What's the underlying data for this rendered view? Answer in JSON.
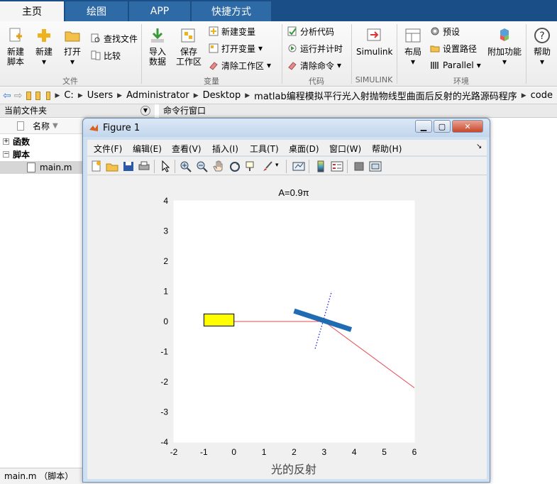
{
  "tabs": [
    {
      "label": "主页",
      "active": true
    },
    {
      "label": "绘图",
      "active": false
    },
    {
      "label": "APP",
      "active": false
    },
    {
      "label": "快捷方式",
      "active": false
    }
  ],
  "ribbon": {
    "file": {
      "new_script": "新建\n脚本",
      "new": "新建",
      "open": "打开",
      "find_files": "查找文件",
      "compare": "比较",
      "group": "文件"
    },
    "variable": {
      "import": "导入\n数据",
      "save_ws": "保存\n工作区",
      "new_var": "新建变量",
      "open_var": "打开变量",
      "clear_ws": "清除工作区",
      "group": "变量"
    },
    "code": {
      "analyze": "分析代码",
      "run_time": "运行并计时",
      "clear_cmd": "清除命令",
      "group": "代码"
    },
    "simulink": {
      "label": "Simulink",
      "group": "SIMULINK"
    },
    "env": {
      "layout": "布局",
      "prefs": "预设",
      "set_path": "设置路径",
      "parallel": "Parallel",
      "addons": "附加功能",
      "group": "环境"
    },
    "help": "帮助"
  },
  "address": {
    "crumbs": [
      "C:",
      "Users",
      "Administrator",
      "Desktop",
      "matlab编程模拟平行光入射抛物线型曲面后反射的光路源码程序",
      "code"
    ]
  },
  "left_panel": {
    "title": "当前文件夹",
    "col_name": "名称",
    "groups": [
      "函数",
      "脚本"
    ],
    "files": [
      "main.m"
    ],
    "footer": "main.m （脚本）"
  },
  "command_window": {
    "title": "命令行窗口"
  },
  "figure": {
    "title": "Figure 1",
    "menu": [
      "文件(F)",
      "编辑(E)",
      "查看(V)",
      "插入(I)",
      "工具(T)",
      "桌面(D)",
      "窗口(W)",
      "帮助(H)"
    ]
  },
  "chart_data": {
    "type": "line",
    "title": "A=0.9π",
    "xlabel": "光的反射",
    "ylabel": "",
    "xlim": [
      -2,
      6
    ],
    "ylim": [
      -4,
      4
    ],
    "xticks": [
      -2,
      -1,
      0,
      1,
      2,
      3,
      4,
      5,
      6
    ],
    "yticks": [
      -4,
      -3,
      -2,
      -1,
      0,
      1,
      2,
      3,
      4
    ],
    "source_box": {
      "x": [
        -1,
        0
      ],
      "y": [
        -0.15,
        0.25
      ],
      "color": "#ffff00"
    },
    "mirror": {
      "x": [
        2.0,
        3.9
      ],
      "y": [
        0.35,
        -0.27
      ],
      "color": "#1f6cb3"
    },
    "normal": {
      "x": [
        2.7,
        3.25
      ],
      "y": [
        -0.9,
        1.0
      ],
      "color": "#1f1fd6"
    },
    "incident_ray": {
      "x": [
        0,
        3.0
      ],
      "y": [
        0,
        0
      ],
      "color": "#e8484e"
    },
    "reflected_ray": {
      "x": [
        3.0,
        6.0
      ],
      "y": [
        0,
        -2.2
      ],
      "color": "#e8484e"
    }
  }
}
